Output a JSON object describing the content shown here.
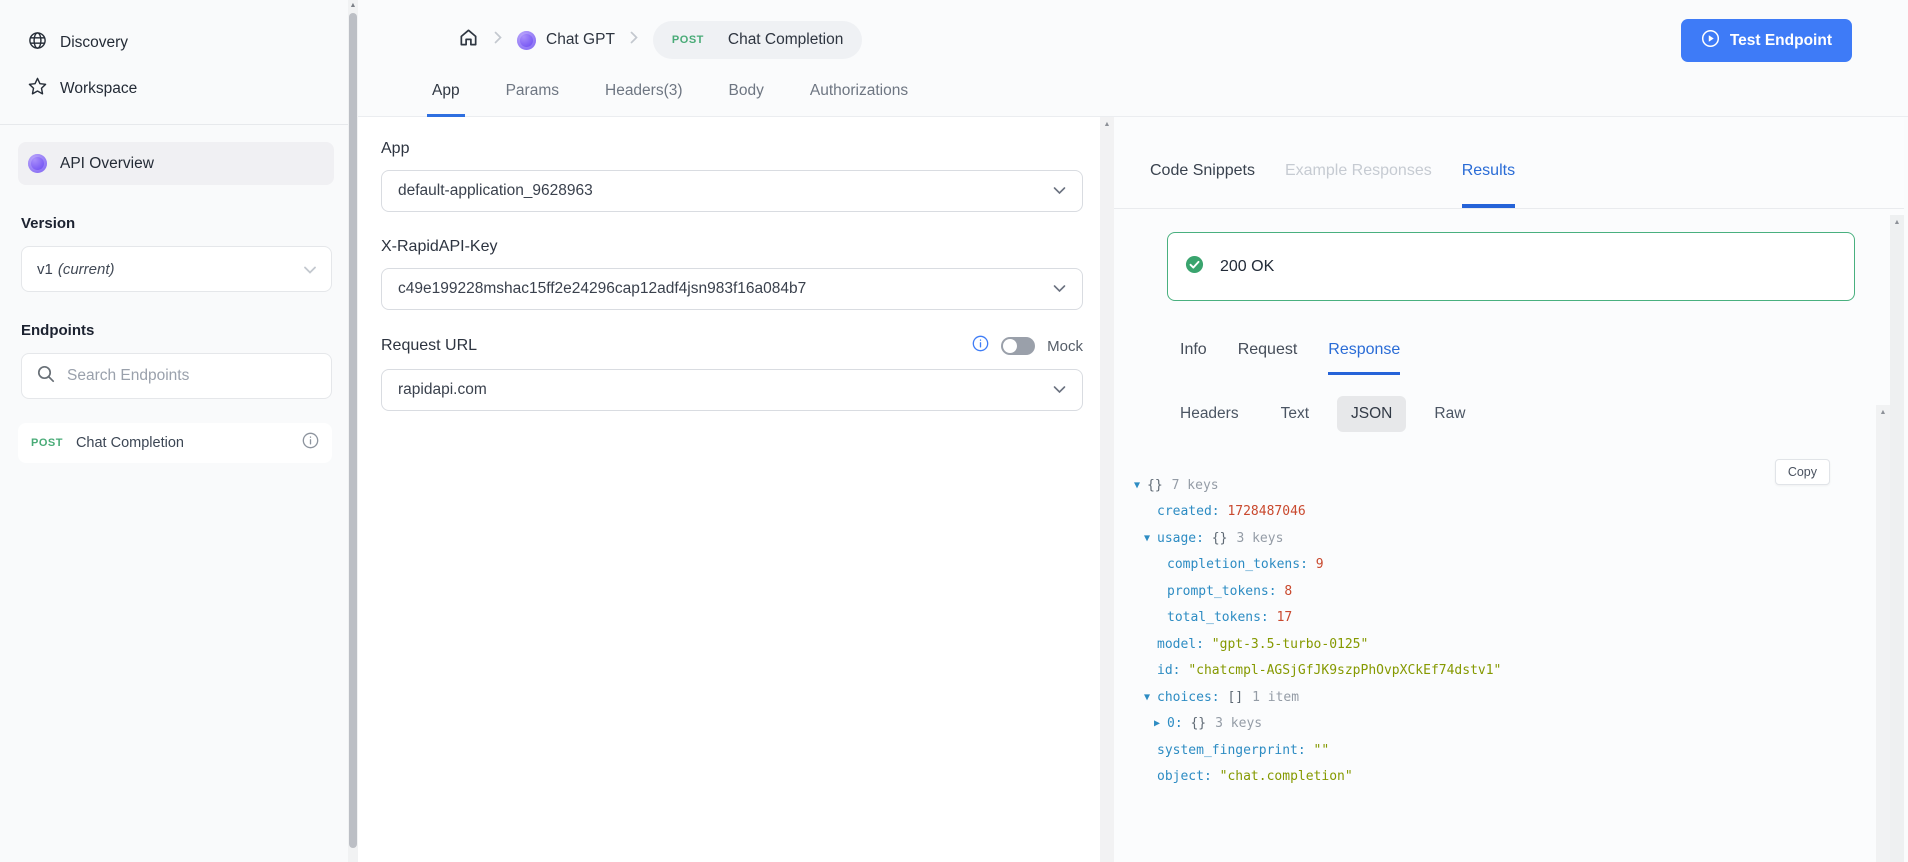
{
  "sidebar": {
    "discovery": "Discovery",
    "workspace": "Workspace",
    "api_overview": "API Overview",
    "version_label": "Version",
    "version_value": "v1",
    "version_note": "(current)",
    "endpoints_label": "Endpoints",
    "search_placeholder": "Search Endpoints",
    "endpoint_method": "POST",
    "endpoint_name": "Chat Completion"
  },
  "header": {
    "crumb_api": "Chat GPT",
    "crumb_method": "POST",
    "crumb_endpoint": "Chat Completion",
    "test_button": "Test Endpoint",
    "tabs": [
      "App",
      "Params",
      "Headers(3)",
      "Body",
      "Authorizations"
    ],
    "active_tab": "App"
  },
  "form": {
    "app_label": "App",
    "app_value": "default-application_9628963",
    "key_label": "X-RapidAPI-Key",
    "key_value": "c49e199228mshac15ff2e24296cap12adf4jsn983f16a084b7",
    "url_label": "Request URL",
    "url_value": "rapidapi.com",
    "mock_label": "Mock",
    "mock_on": false
  },
  "results": {
    "tabs": [
      "Code Snippets",
      "Example Responses",
      "Results"
    ],
    "active_tab": "Results",
    "status_text": "200 OK",
    "sub_tabs": [
      "Info",
      "Request",
      "Response"
    ],
    "active_sub_tab": "Response",
    "view_buttons": [
      "Headers",
      "Text",
      "JSON",
      "Raw"
    ],
    "active_view": "JSON",
    "copy_label": "Copy",
    "json_rows": [
      {
        "indent": 0,
        "arrow": "▼",
        "key": "",
        "brace": "{}",
        "meta": "7 keys"
      },
      {
        "indent": 1,
        "arrow": "",
        "key": "created",
        "value": "1728487046",
        "vtype": "number"
      },
      {
        "indent": 1,
        "arrow": "▼",
        "key": "usage",
        "brace": "{}",
        "meta": "3 keys"
      },
      {
        "indent": 2,
        "arrow": "",
        "key": "completion_tokens",
        "value": "9",
        "vtype": "number"
      },
      {
        "indent": 2,
        "arrow": "",
        "key": "prompt_tokens",
        "value": "8",
        "vtype": "number"
      },
      {
        "indent": 2,
        "arrow": "",
        "key": "total_tokens",
        "value": "17",
        "vtype": "number"
      },
      {
        "indent": 1,
        "arrow": "",
        "key": "model",
        "value": "\"gpt-3.5-turbo-0125\"",
        "vtype": "string"
      },
      {
        "indent": 1,
        "arrow": "",
        "key": "id",
        "value": "\"chatcmpl-AGSjGfJK9szpPhOvpXCkEf74dstv1\"",
        "vtype": "string"
      },
      {
        "indent": 1,
        "arrow": "▼",
        "key": "choices",
        "brace": "[]",
        "meta": "1 item"
      },
      {
        "indent": 2,
        "arrow": "▶",
        "key": "0",
        "brace": "{}",
        "meta": "3 keys"
      },
      {
        "indent": 1,
        "arrow": "",
        "key": "system_fingerprint",
        "value": "\"\"",
        "vtype": "string"
      },
      {
        "indent": 1,
        "arrow": "",
        "key": "object",
        "value": "\"chat.completion\"",
        "vtype": "string"
      }
    ]
  },
  "colors": {
    "accent_blue": "#2e6fe0",
    "button_blue": "#3e7bf7",
    "method_green": "#49ab77",
    "status_border_green": "#49b07f",
    "json_key_blue": "#2d8cc3",
    "json_number_red": "#c9492e",
    "json_string_olive": "#859900"
  },
  "icons": {
    "expanded_arrow": "▼",
    "collapsed_arrow": "▶",
    "scroll_up_arrow": "▲"
  }
}
